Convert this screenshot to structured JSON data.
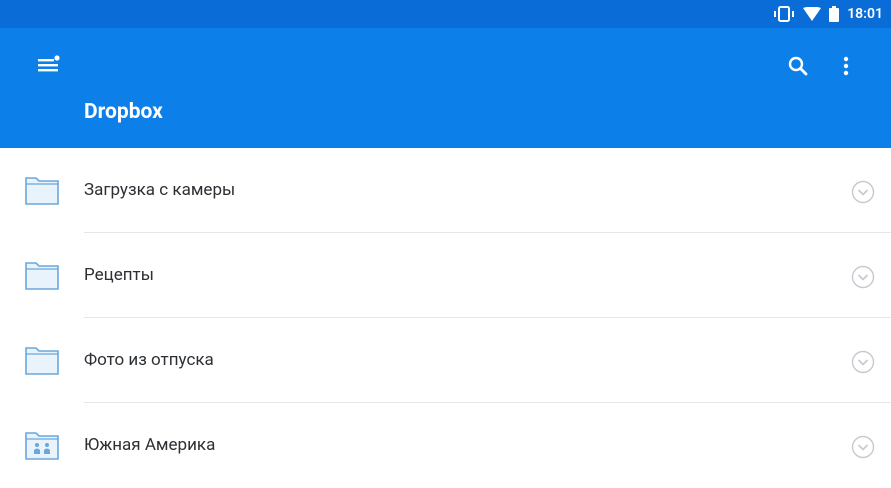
{
  "status_bar": {
    "time": "18:01"
  },
  "app_bar": {
    "title": "Dropbox"
  },
  "folders": [
    {
      "name": "Загрузка с камеры",
      "type": "folder"
    },
    {
      "name": "Рецепты",
      "type": "folder"
    },
    {
      "name": "Фото из отпуска",
      "type": "folder"
    },
    {
      "name": "Южная Америка",
      "type": "shared-folder"
    }
  ],
  "colors": {
    "status_bar": "#0a6cd6",
    "app_bar": "#0d7fe8",
    "folder_stroke": "#6aa7dc",
    "folder_fill": "#e9f3fc"
  },
  "icons": {
    "status": [
      "vibrate-icon",
      "wifi-icon",
      "battery-icon"
    ],
    "app_bar": [
      "menu-icon",
      "search-icon",
      "more-vert-icon"
    ],
    "row_action": "chevron-down-circle-icon"
  }
}
